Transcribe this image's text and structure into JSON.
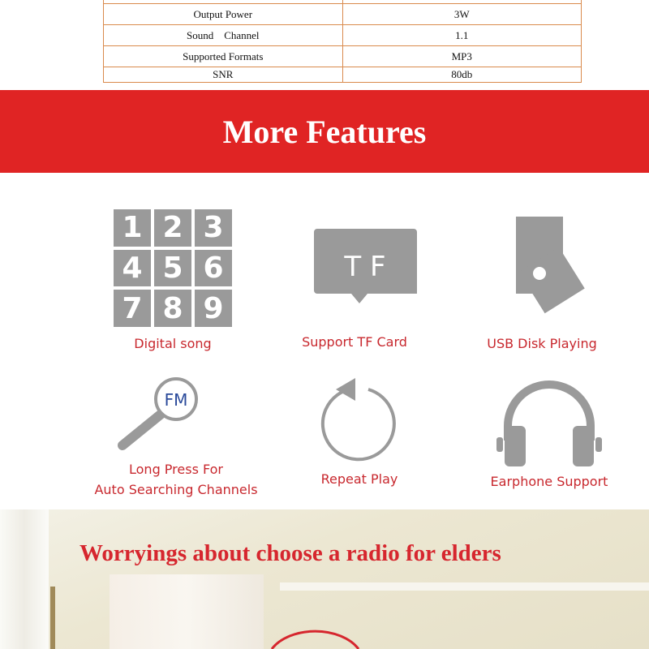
{
  "spec_table": [
    {
      "label": "",
      "value": ""
    },
    {
      "label": "Output Power",
      "value": "3W"
    },
    {
      "label": "Sound    Channel",
      "value": "1.1"
    },
    {
      "label": "Supported Formats",
      "value": "MP3"
    },
    {
      "label": "SNR",
      "value": "80db"
    }
  ],
  "section_title": "More Features",
  "features": [
    {
      "label": "Digital song",
      "icon": "numpad-icon",
      "digits": [
        "1",
        "2",
        "3",
        "4",
        "5",
        "6",
        "7",
        "8",
        "9"
      ]
    },
    {
      "label": "Support TF Card",
      "icon": "tf-card-icon",
      "icon_text": "T F"
    },
    {
      "label": "USB Disk Playing",
      "icon": "usb-disk-icon"
    },
    {
      "label": "Long Press For",
      "label2": "Auto Searching Channels",
      "icon": "fm-search-icon",
      "icon_text": "FM"
    },
    {
      "label": "Repeat Play",
      "icon": "repeat-icon"
    },
    {
      "label": "Earphone Support",
      "icon": "headphones-icon"
    }
  ],
  "banner_title": "Worryings about choose a radio for elders",
  "colors": {
    "accent": "#e02424",
    "icon_gray": "#9a9a9a",
    "label_red": "#c8282e"
  }
}
